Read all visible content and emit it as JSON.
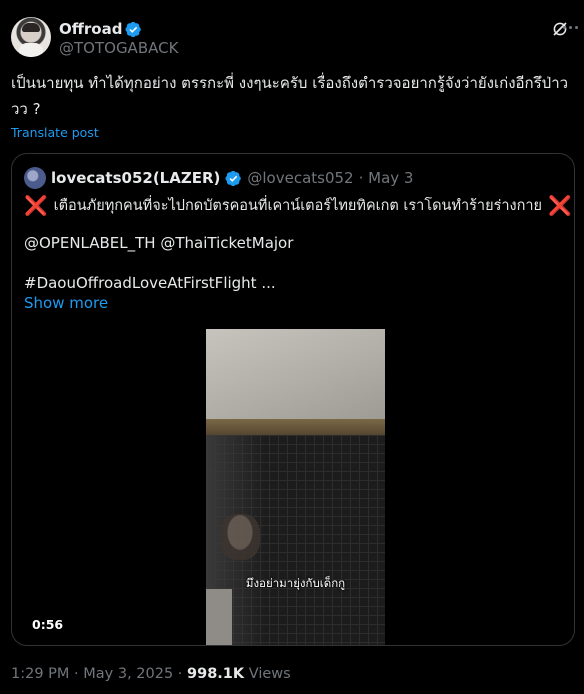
{
  "post": {
    "author": {
      "display_name": "Offroad",
      "handle": "@TOTOGABACK",
      "verified": true,
      "avatar_icon": "avatar-photo"
    },
    "text": "เป็นนายทุน ทำได้ทุกอย่าง ตรรกะพี่ งงๆนะครับ เรื่องถึงตำรวจอยากรู้จังว่ายังเก่งอีกรึป่าววว ?",
    "translate_label": "Translate post",
    "grok_icon": "grok-slash-icon",
    "more_icon": "more-dots-icon",
    "timestamp": "1:29 PM · May 3, 2025",
    "separator": " · ",
    "views_count": "998.1K",
    "views_label": " Views"
  },
  "quote": {
    "display_name": "lovecats052(LAZER)",
    "handle": "@lovecats052",
    "date": "· May 3",
    "verified": true,
    "line1": "เตือนภัยทุกคนที่จะไปกดบัตรคอนที่เคาน์เตอร์ไทยทิคเกต เราโดนทำร้ายร่างกาย",
    "x_mark": "❌",
    "line2": "@OPENLABEL_TH @ThaiTicketMajor",
    "line3": "#DaouOffroadLoveAtFirstFlight ...",
    "show_more": "Show more",
    "video": {
      "caption": "มึงอย่ามายุ่งกับเด็กกู",
      "duration": "0:56"
    }
  },
  "colors": {
    "background": "#000000",
    "text": "#e7e9ea",
    "muted": "#71767b",
    "link": "#1d9bf0",
    "border": "#2f3336",
    "x_mark": "#e0245e"
  }
}
